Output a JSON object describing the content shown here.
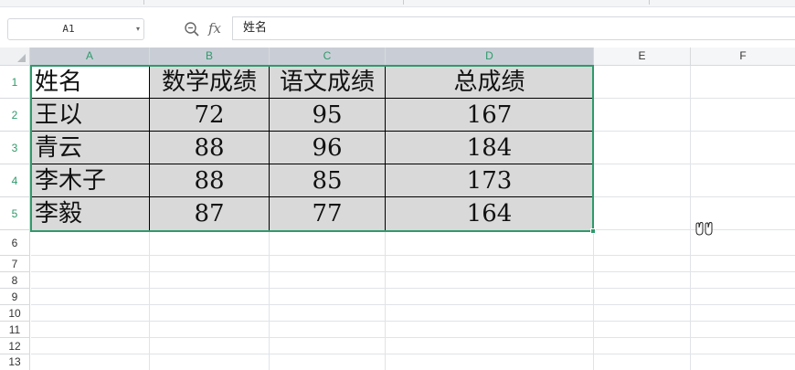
{
  "name_box": {
    "value": "A1"
  },
  "formula": {
    "fx_label": "fx",
    "value": "姓名"
  },
  "columns": [
    {
      "label": "A",
      "selected": true
    },
    {
      "label": "B",
      "selected": true
    },
    {
      "label": "C",
      "selected": true
    },
    {
      "label": "D",
      "selected": true
    },
    {
      "label": "E",
      "selected": false
    },
    {
      "label": "F",
      "selected": false
    }
  ],
  "rows": [
    {
      "label": "1",
      "selected": true
    },
    {
      "label": "2",
      "selected": true
    },
    {
      "label": "3",
      "selected": true
    },
    {
      "label": "4",
      "selected": true
    },
    {
      "label": "5",
      "selected": true
    },
    {
      "label": "6",
      "selected": false
    },
    {
      "label": "7",
      "selected": false
    },
    {
      "label": "8",
      "selected": false
    },
    {
      "label": "9",
      "selected": false
    },
    {
      "label": "10",
      "selected": false
    },
    {
      "label": "11",
      "selected": false
    },
    {
      "label": "12",
      "selected": false
    },
    {
      "label": "13",
      "selected": false
    }
  ],
  "table": {
    "headers": [
      "姓名",
      "数学成绩",
      "语文成绩",
      "总成绩"
    ],
    "rows": [
      [
        "王以",
        "72",
        "95",
        "167"
      ],
      [
        "青云",
        "88",
        "96",
        "184"
      ],
      [
        "李木子",
        "88",
        "85",
        "173"
      ],
      [
        "李毅",
        "87",
        "77",
        "164"
      ]
    ]
  },
  "colors": {
    "selection": "#2f9a6b",
    "cell_fill": "#d9d9d9",
    "header_selected": "#c9ced6"
  },
  "icons": {
    "zoom": "zoom-in-icon",
    "fx": "function-icon",
    "cursor": "hand-cursor-icon"
  }
}
